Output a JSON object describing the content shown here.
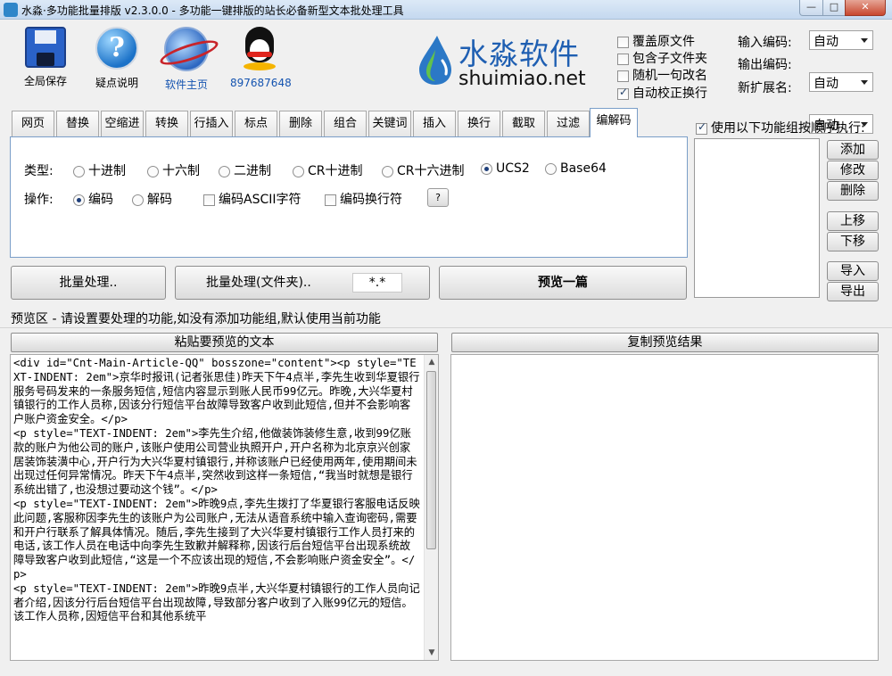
{
  "window": {
    "title": "水淼·多功能批量排版 v2.3.0.0 - 多功能一键排版的站长必备新型文本批处理工具",
    "min_label": "—",
    "max_label": "□",
    "close_label": "✕"
  },
  "toolbar": {
    "save_label": "全局保存",
    "help_label": "疑点说明",
    "home_label": "软件主页",
    "qq_label": "897687648",
    "help_glyph": "?"
  },
  "logo": {
    "cn": "水淼软件",
    "en": "shuimiao.net"
  },
  "options": {
    "overwrite": {
      "label": "覆盖原文件",
      "checked": false
    },
    "include_sub": {
      "label": "包含子文件夹",
      "checked": false
    },
    "random_rename": {
      "label": "随机一句改名",
      "checked": false
    },
    "auto_fix_newline": {
      "label": "自动校正换行",
      "checked": true
    }
  },
  "encoding": {
    "input_label": "输入编码:",
    "input_value": "自动",
    "output_label": "输出编码:",
    "output_value": "自动",
    "ext_label": "新扩展名:",
    "ext_value": "自动"
  },
  "tabs": [
    "网页",
    "替换",
    "空缩进",
    "转换",
    "行插入",
    "标点",
    "删除",
    "组合",
    "关键词",
    "插入",
    "换行",
    "截取",
    "过滤",
    "编解码"
  ],
  "active_tab": "编解码",
  "codec_panel": {
    "type_label": "类型:",
    "types": [
      {
        "label": "十进制",
        "selected": false
      },
      {
        "label": "十六制",
        "selected": false
      },
      {
        "label": "二进制",
        "selected": false
      },
      {
        "label": "CR十进制",
        "selected": false
      },
      {
        "label": "CR十六进制",
        "selected": false
      },
      {
        "label": "UCS2",
        "selected": true
      },
      {
        "label": "Base64",
        "selected": false
      }
    ],
    "op_label": "操作:",
    "encode_label": "编码",
    "decode_label": "解码",
    "encode_selected": true,
    "ascii_label": "编码ASCII字符",
    "newline_label": "编码换行符",
    "help_glyph": "?"
  },
  "func_group": {
    "checkbox_label": "使用以下功能组按顺序执行:",
    "checked": true,
    "add": "添加",
    "edit": "修改",
    "delete": "删除",
    "up": "上移",
    "down": "下移",
    "import": "导入",
    "export": "导出"
  },
  "batch": {
    "batch_label": "批量处理..",
    "batch_folder_label": "批量处理(文件夹)..",
    "pattern": "*.*",
    "preview_label": "预览一篇"
  },
  "preview": {
    "hint": "预览区 - 请设置要处理的功能,如没有添加功能组,默认使用当前功能",
    "paste_label": "粘贴要预览的文本",
    "copy_label": "复制预览结果",
    "source_text": "<div id=\"Cnt-Main-Article-QQ\" bosszone=\"content\"><p style=\"TEXT-INDENT: 2em\">京华时报讯(记者张思佳)昨天下午4点半,李先生收到华夏银行服务号码发来的一条服务短信,短信内容显示到账人民币99亿元。昨晚,大兴华夏村镇银行的工作人员称,因该分行短信平台故障导致客户收到此短信,但并不会影响客户账户资金安全。</p>\n<p style=\"TEXT-INDENT: 2em\">李先生介绍,他做装饰装修生意,收到99亿账款的账户为他公司的账户,该账户使用公司营业执照开户,开户名称为北京京兴创家居装饰装潢中心,开户行为大兴华夏村镇银行,并称该账户已经使用两年,使用期间未出现过任何异常情况。昨天下午4点半,突然收到这样一条短信,“我当时就想是银行系统出错了,也没想过要动这个钱”。</p>\n<p style=\"TEXT-INDENT: 2em\">昨晚9点,李先生拨打了华夏银行客服电话反映此问题,客服称因李先生的该账户为公司账户,无法从语音系统中输入查询密码,需要和开户行联系了解具体情况。随后,李先生接到了大兴华夏村镇银行工作人员打来的电话,该工作人员在电话中向李先生致歉并解释称,因该行后台短信平台出现系统故障导致客户收到此短信,“这是一个不应该出现的短信,不会影响账户资金安全”。</p>\n<p style=\"TEXT-INDENT: 2em\">昨晚9点半,大兴华夏村镇银行的工作人员向记者介绍,因该分行后台短信平台出现故障,导致部分客户收到了入账99亿元的短信。该工作人员称,因短信平台和其他系统平"
  }
}
